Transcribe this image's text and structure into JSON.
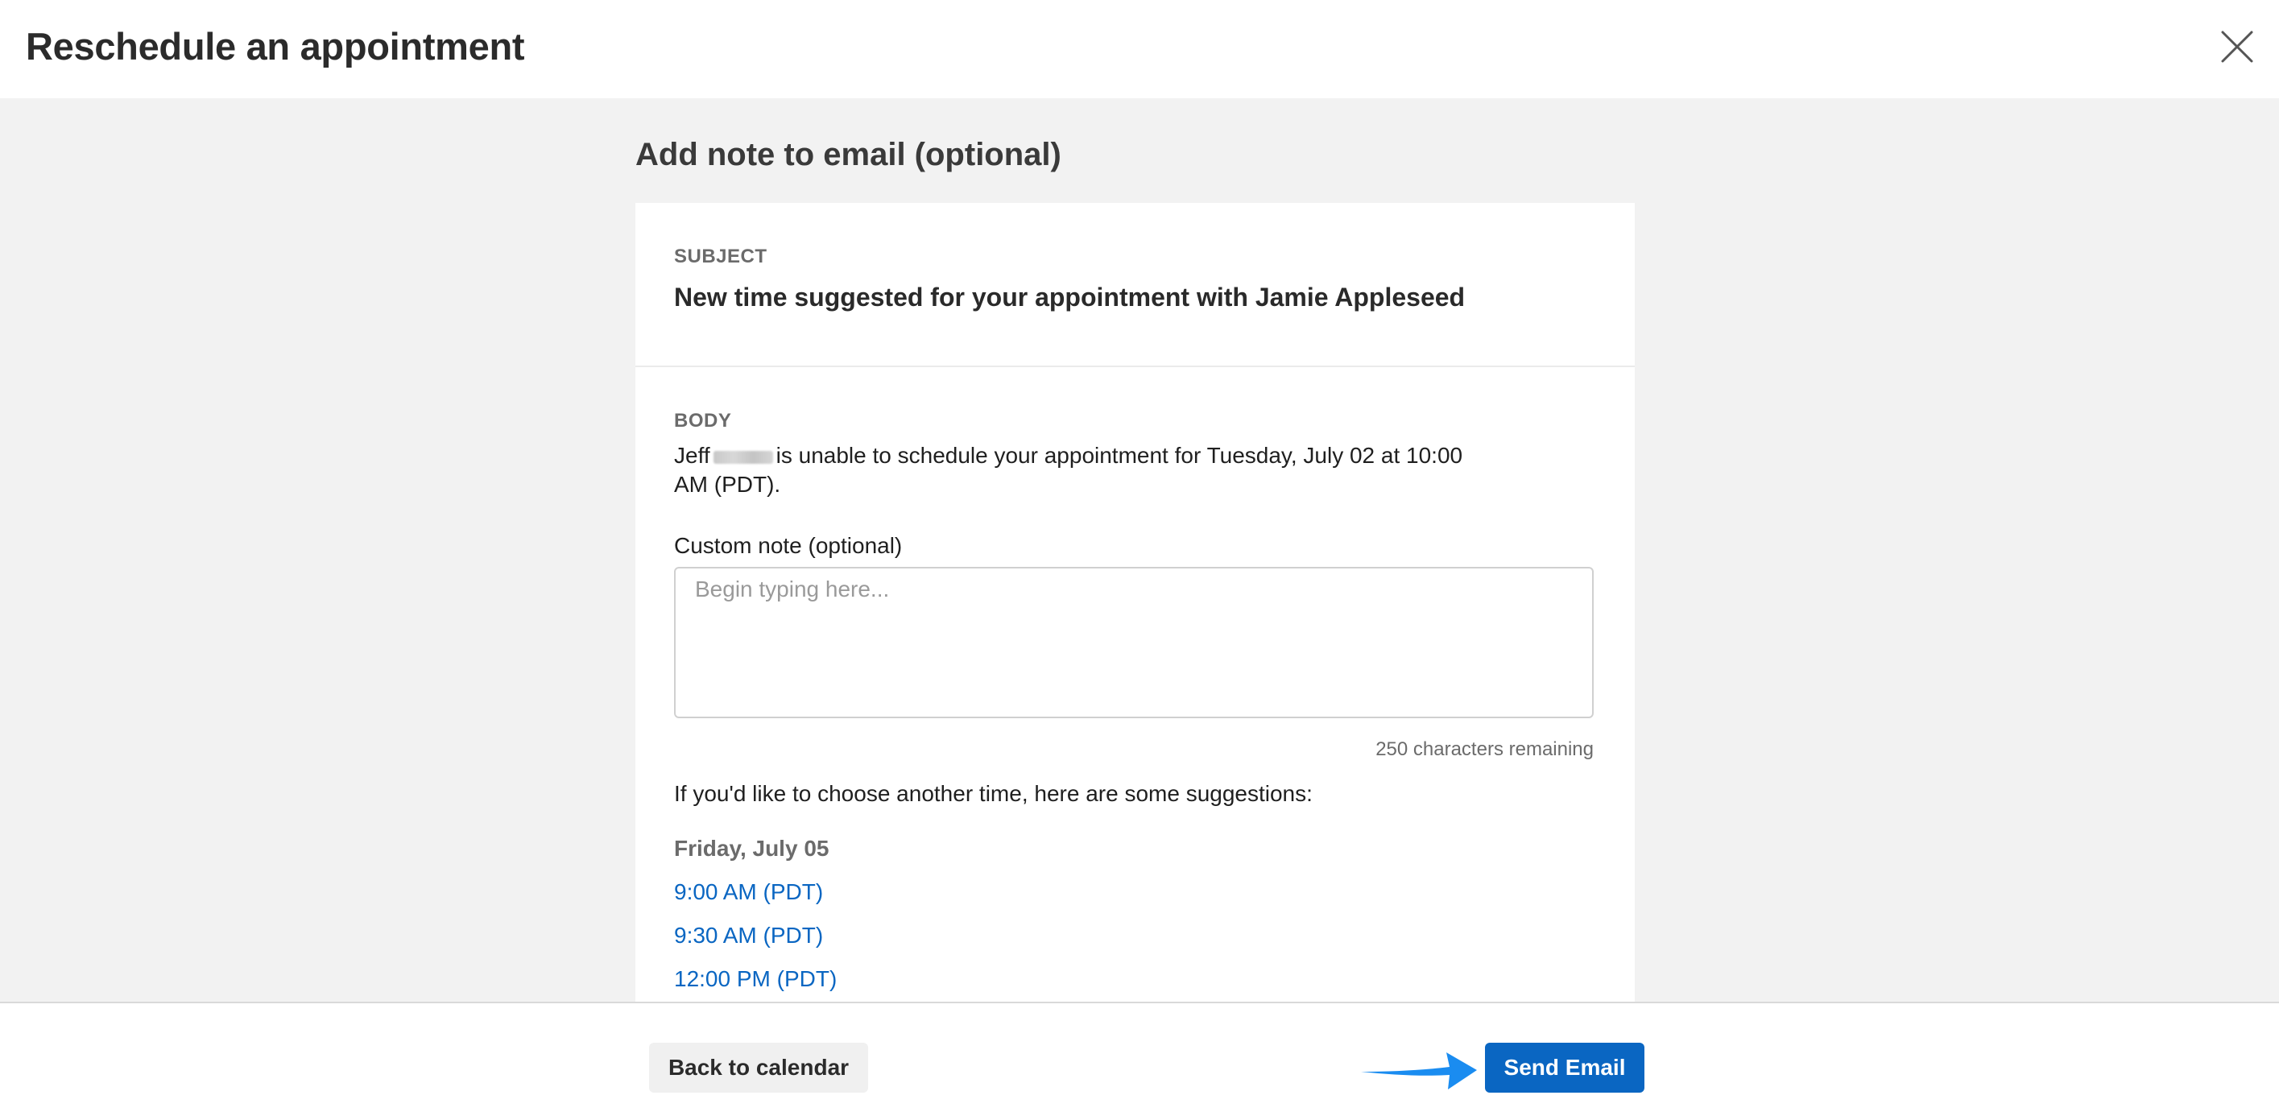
{
  "header": {
    "title": "Reschedule an appointment",
    "close_icon": "close-icon"
  },
  "main": {
    "section_title": "Add note to email (optional)",
    "subject": {
      "label": "SUBJECT",
      "text": "New time suggested for your appointment with Jamie Appleseed"
    },
    "body": {
      "label": "BODY",
      "sender_first_name": "Jeff",
      "message_part": "is unable to schedule your appointment for Tuesday, July 02 at 10:00 AM (PDT).",
      "custom_note_label": "Custom note (optional)",
      "custom_note_placeholder": "Begin typing here...",
      "custom_note_value": "",
      "chars_remaining": "250 characters remaining",
      "suggestions_intro": "If you'd like to choose another time, here are some suggestions:",
      "suggestions": [
        {
          "date": "Friday, July 05",
          "times": [
            "9:00 AM (PDT)",
            "9:30 AM (PDT)",
            "12:00 PM (PDT)"
          ]
        }
      ]
    }
  },
  "footer": {
    "back_label": "Back to calendar",
    "send_label": "Send Email"
  },
  "colors": {
    "accent": "#0a66c2",
    "pointer_arrow": "#1a8cf0",
    "page_background": "#f2f2f2"
  }
}
